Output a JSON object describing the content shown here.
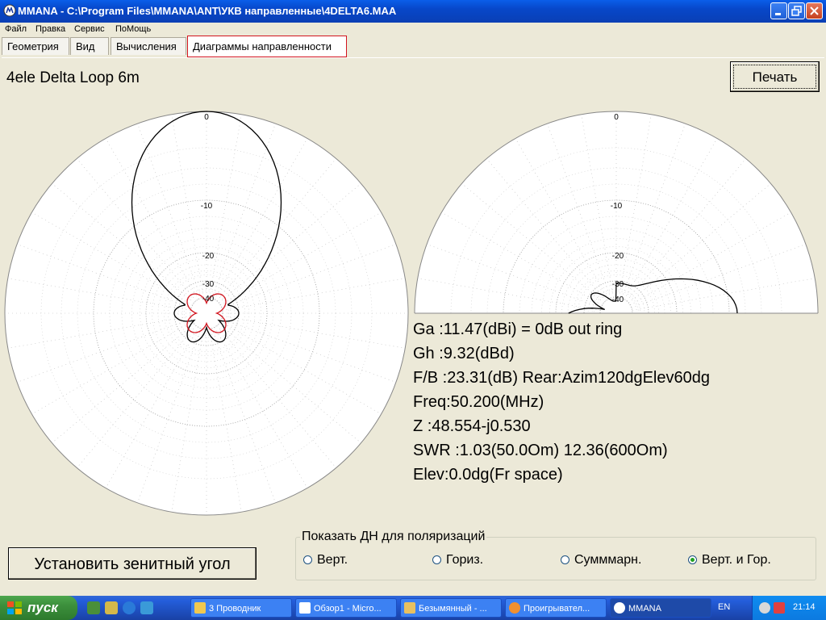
{
  "window": {
    "title": "MMANA - C:\\Program Files\\MMANA\\ANT\\УКВ направленные\\4DELTA6.MAA"
  },
  "menu": [
    "Файл",
    "Правка",
    "Сервис",
    "ПоМощь"
  ],
  "tabs": [
    {
      "label": "Геометрия",
      "active": false
    },
    {
      "label": "Вид",
      "active": false
    },
    {
      "label": "Вычисления",
      "active": false
    },
    {
      "label": "Диаграммы направленности",
      "active": true
    }
  ],
  "antenna_name": "4ele Delta Loop 6m",
  "print_button": "Печать",
  "polar_rings": [
    "0",
    "-10",
    "-20",
    "-30",
    "-40"
  ],
  "results": {
    "ga": "Ga  :11.47(dBi) = 0dB  out ring",
    "gh": "Gh  :9.32(dBd)",
    "fb": "F/B :23.31(dB) Rear:Azim120dgElev60dg",
    "freq": "Freq:50.200(MHz)",
    "z": "Z   :48.554-j0.530",
    "swr": "SWR :1.03(50.0Om) 12.36(600Om)",
    "elev": "Elev:0.0dg(Fr space)"
  },
  "zenith_button": "Установить зенитный угол",
  "polarization": {
    "label": "Показать ДН для поляризаций",
    "options": [
      {
        "label": "Верт.",
        "selected": false
      },
      {
        "label": "Гориз.",
        "selected": false
      },
      {
        "label": "Сумммарн.",
        "selected": false
      },
      {
        "label": "Верт. и Гор.",
        "selected": true
      }
    ]
  },
  "taskbar": {
    "start": "пуск",
    "tasks": [
      {
        "label": "3 Проводник",
        "active": false
      },
      {
        "label": "Обзор1 - Micro...",
        "active": false
      },
      {
        "label": "Безымянный - ...",
        "active": false
      },
      {
        "label": "Проигрывател...",
        "active": false
      },
      {
        "label": "MMANA",
        "active": true
      }
    ],
    "language": "EN",
    "clock": "21:14"
  },
  "colors": {
    "horizontal_pattern": "#000000",
    "vertical_pattern": "#d2141e",
    "active_tab_border": "#d2141e"
  }
}
